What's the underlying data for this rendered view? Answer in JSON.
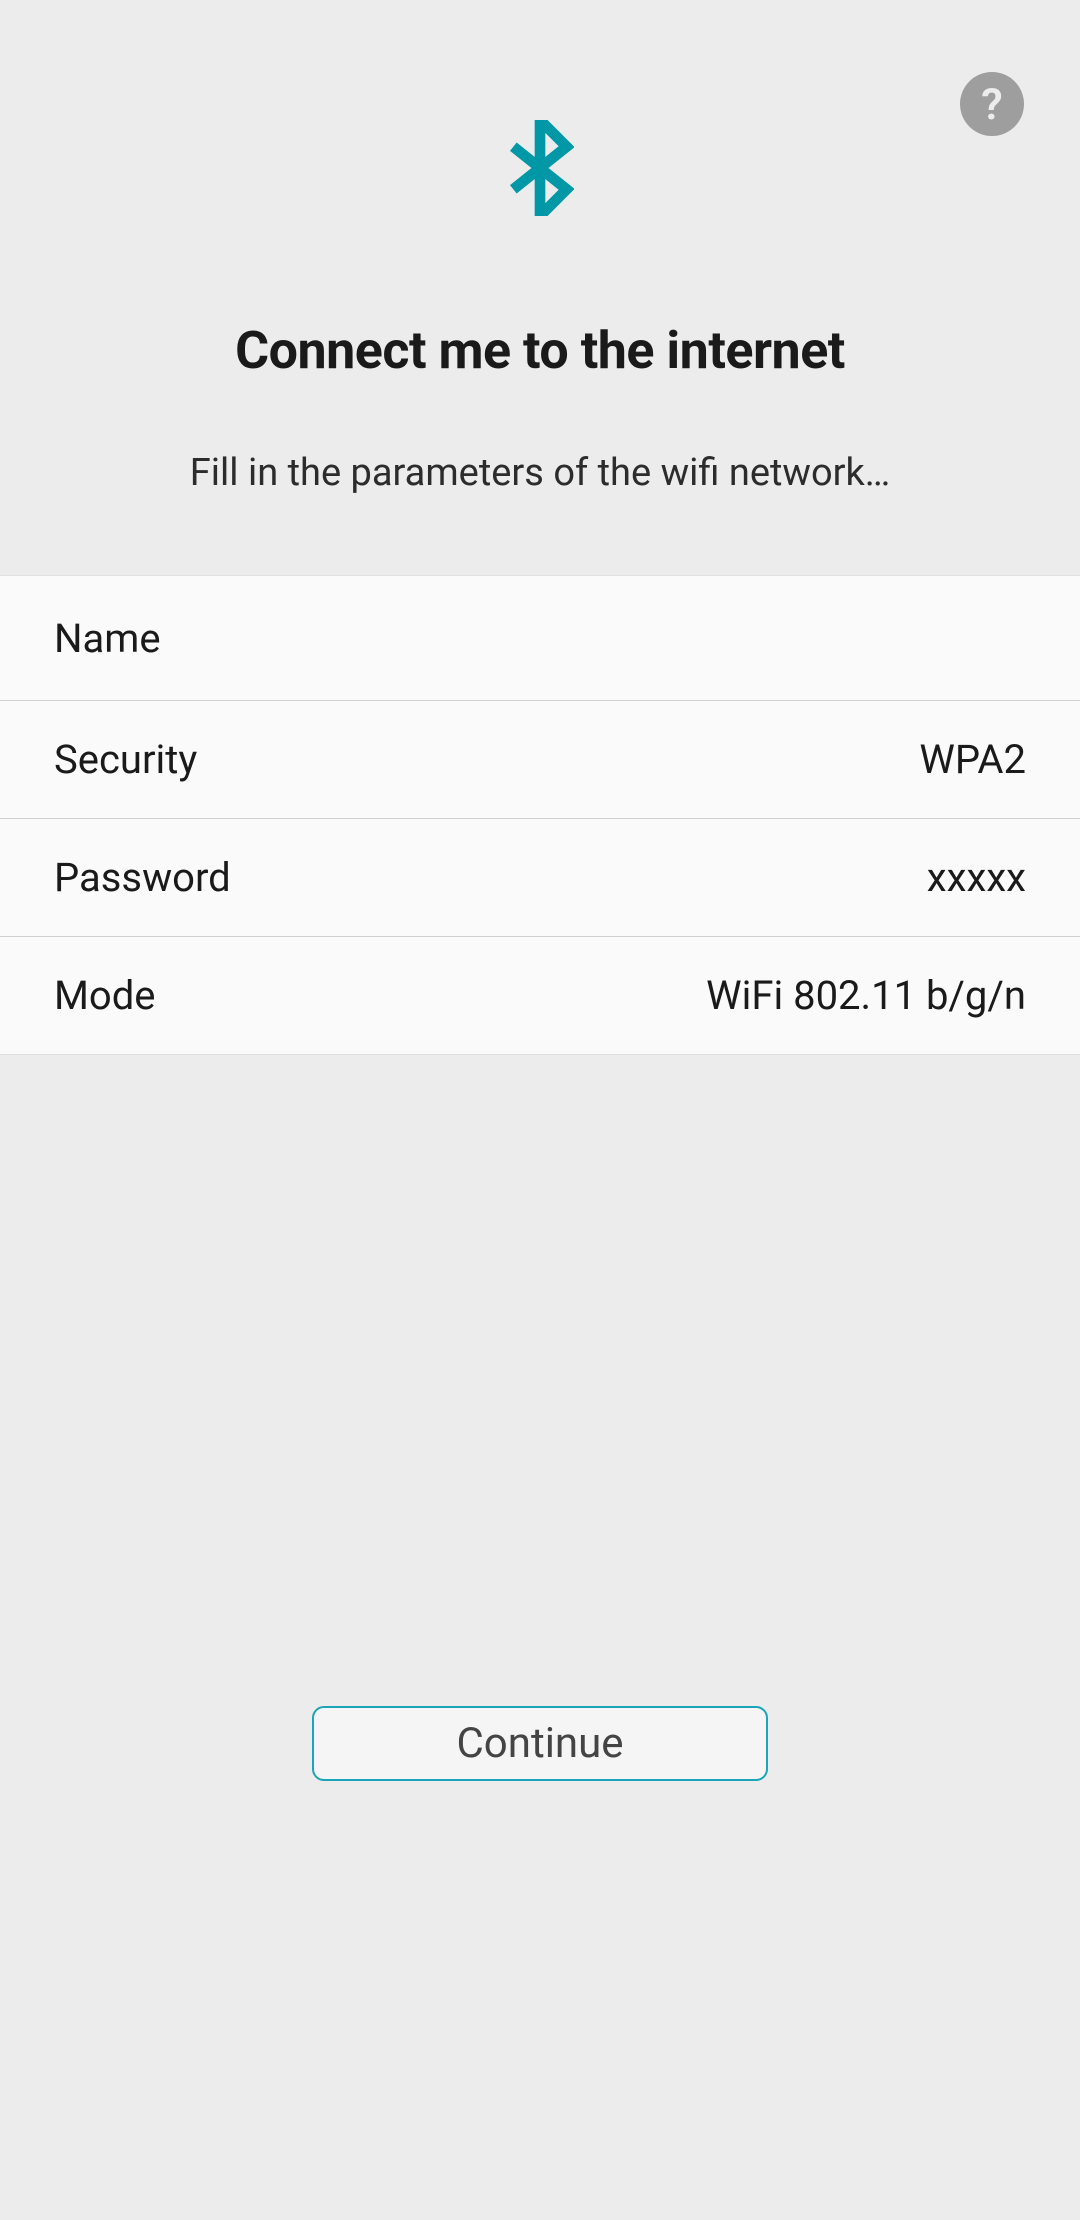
{
  "header": {
    "title": "Connect me to the internet",
    "subtitle": "Fill in the parameters of the wifi network…",
    "help_symbol": "?"
  },
  "form": {
    "rows": [
      {
        "label": "Name",
        "value": ""
      },
      {
        "label": "Security",
        "value": "WPA2"
      },
      {
        "label": "Password",
        "value": "xxxxx"
      },
      {
        "label": "Mode",
        "value": "WiFi 802.11 b/g/n"
      }
    ]
  },
  "actions": {
    "continue_label": "Continue"
  },
  "colors": {
    "accent": "#0097a7"
  }
}
